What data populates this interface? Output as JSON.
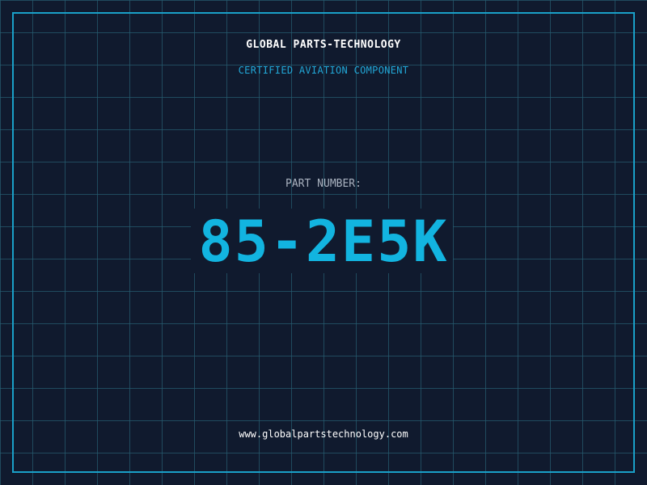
{
  "header": {
    "title": "GLOBAL PARTS-TECHNOLOGY",
    "subtitle": "CERTIFIED AVIATION COMPONENT"
  },
  "part": {
    "label": "PART NUMBER:",
    "number": "85-2E5K"
  },
  "footer": {
    "website": "www.globalpartstechnology.com"
  },
  "colors": {
    "background": "#101a2e",
    "grid": "#265a6e",
    "frame": "#1aa0c8",
    "accent": "#12b4e0",
    "title": "#ffffff",
    "label": "#aab3c0"
  }
}
